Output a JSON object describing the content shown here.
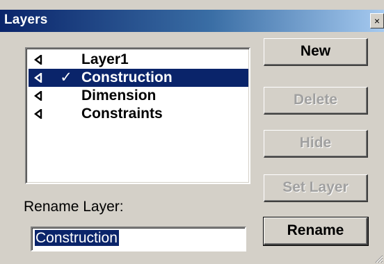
{
  "window": {
    "title": "Layers",
    "close_symbol": "×"
  },
  "layers": {
    "items": [
      {
        "icon": "speaker-icon",
        "check": "",
        "label": "Layer1",
        "selected": false
      },
      {
        "icon": "speaker-icon",
        "check": "✓",
        "label": "Construction",
        "selected": true
      },
      {
        "icon": "speaker-icon",
        "check": "",
        "label": "Dimension",
        "selected": false
      },
      {
        "icon": "speaker-icon",
        "check": "",
        "label": "Constraints",
        "selected": false
      }
    ]
  },
  "rename": {
    "label": "Rename Layer:",
    "value": "Construction"
  },
  "buttons": {
    "new": "New",
    "delete": "Delete",
    "hide": "Hide",
    "set_layer": "Set Layer",
    "rename": "Rename"
  },
  "colors": {
    "selection": "#0a246a",
    "face": "#d4d0c8",
    "disabled_text": "#a0a0a0"
  }
}
